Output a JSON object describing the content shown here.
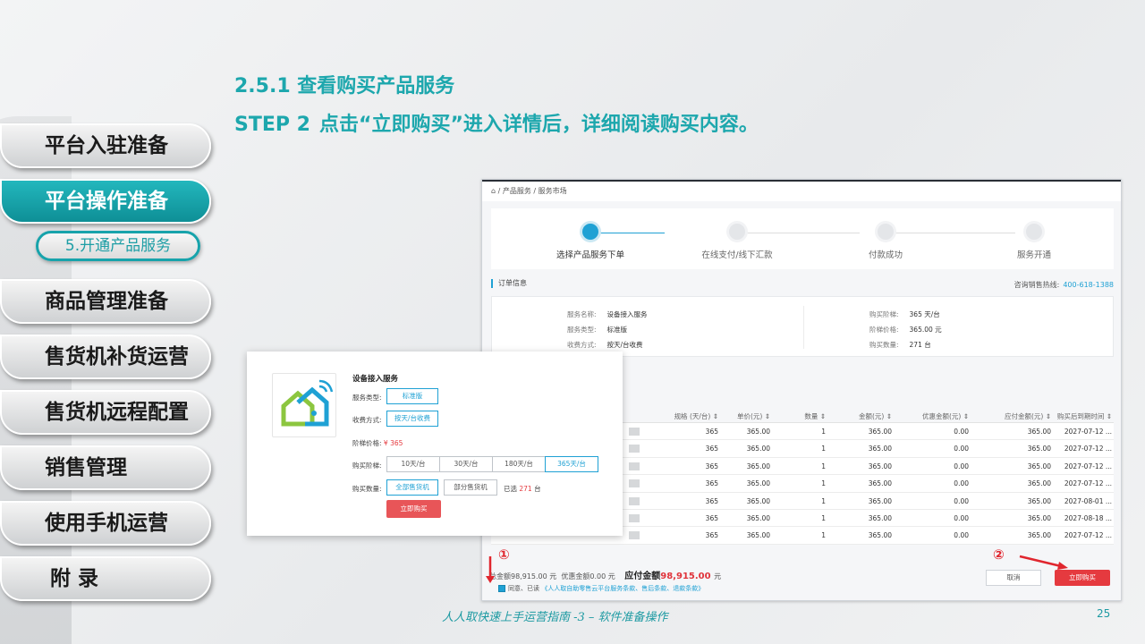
{
  "heading": "2.5.1 查看购买产品服务",
  "step": {
    "label": "STEP 2",
    "text": "点击“立即购买”进入详情后，详细阅读购买内容。"
  },
  "nav": {
    "items": [
      {
        "label": "平台入驻准备",
        "active": false
      },
      {
        "label": "平台操作准备",
        "active": true
      },
      {
        "label": "商品管理准备",
        "active": false
      },
      {
        "label": "售货机补货运营",
        "active": false
      },
      {
        "label": "售货机远程配置",
        "active": false
      },
      {
        "label": "销售管理",
        "active": false
      },
      {
        "label": "使用手机运营",
        "active": false
      },
      {
        "label": "附 录",
        "active": false
      }
    ],
    "sub_item": "5.开通产品服务"
  },
  "screenshot": {
    "breadcrumb": [
      "产品服务",
      "服务市场"
    ],
    "steps": [
      "选择产品服务下单",
      "在线支付/线下汇款",
      "付款成功",
      "服务开通"
    ],
    "order_info_title": "订单信息",
    "hotline_label": "咨询销售热线:",
    "hotline": "400-618-1388",
    "info": {
      "name_label": "服务名称:",
      "name": "设备接入服务",
      "type_label": "服务类型:",
      "type": "标准版",
      "charge_label": "收费方式:",
      "charge": "按天/台收费",
      "tier_label": "购买阶梯:",
      "tier": "365 天/台",
      "price_label": "阶梯价格:",
      "price": "365.00 元",
      "qty_label": "购买数量:",
      "qty": "271 台"
    },
    "table": {
      "headers": [
        "号 ⇕",
        "规格 (天/台) ⇕",
        "单价(元) ⇕",
        "数量 ⇕",
        "金额(元) ⇕",
        "优惠金额(元) ⇕",
        "应付金额(元) ⇕",
        "购买后到期时间 ⇕"
      ],
      "rows": [
        [
          "365",
          "365.00",
          "1",
          "365.00",
          "0.00",
          "365.00",
          "2027-07-12 ..."
        ],
        [
          "365",
          "365.00",
          "1",
          "365.00",
          "0.00",
          "365.00",
          "2027-07-12 ..."
        ],
        [
          "365",
          "365.00",
          "1",
          "365.00",
          "0.00",
          "365.00",
          "2027-07-12 ..."
        ],
        [
          "365",
          "365.00",
          "1",
          "365.00",
          "0.00",
          "365.00",
          "2027-07-12 ..."
        ],
        [
          "365",
          "365.00",
          "1",
          "365.00",
          "0.00",
          "365.00",
          "2027-08-01 ..."
        ],
        [
          "365",
          "365.00",
          "1",
          "365.00",
          "0.00",
          "365.00",
          "2027-08-18 ..."
        ],
        [
          "365",
          "365.00",
          "1",
          "365.00",
          "0.00",
          "365.00",
          "2027-07-12 ..."
        ]
      ]
    },
    "summary": {
      "total": "总金额98,915.00 元",
      "discount": "优惠金额0.00 元",
      "payable_label": "应付金额",
      "payable": "98,915.00",
      "payable_unit": "元"
    },
    "agree_text": "同意、已读",
    "agree_links": "《人人取自助零售云平台服务条款、售后条款、退款条款》",
    "cancel_label": "取消",
    "buy_label": "立即购买"
  },
  "card": {
    "title": "设备接入服务",
    "type_label": "服务类型:",
    "type": "标准版",
    "charge_label": "收费方式:",
    "charge": "按天/台收费",
    "price_label": "阶梯价格:",
    "price": "¥ 365",
    "tier_label": "购买阶梯:",
    "tiers": [
      "10天/台",
      "30天/台",
      "180天/台",
      "365天/台"
    ],
    "qty_label": "购买数量:",
    "qty_options": [
      "全部售货机",
      "部分售货机"
    ],
    "selected_prefix": "已选",
    "selected_count": "271",
    "selected_unit": "台",
    "buy_label": "立即购买"
  },
  "markers": [
    "①",
    "②"
  ],
  "footer": "人人取快速上手运营指南 -3 – 软件准备操作",
  "page_number": "25",
  "colors": {
    "accent": "#1da7ad",
    "primary_blue": "#1fa1d4",
    "buy_red": "#e53a3f"
  }
}
